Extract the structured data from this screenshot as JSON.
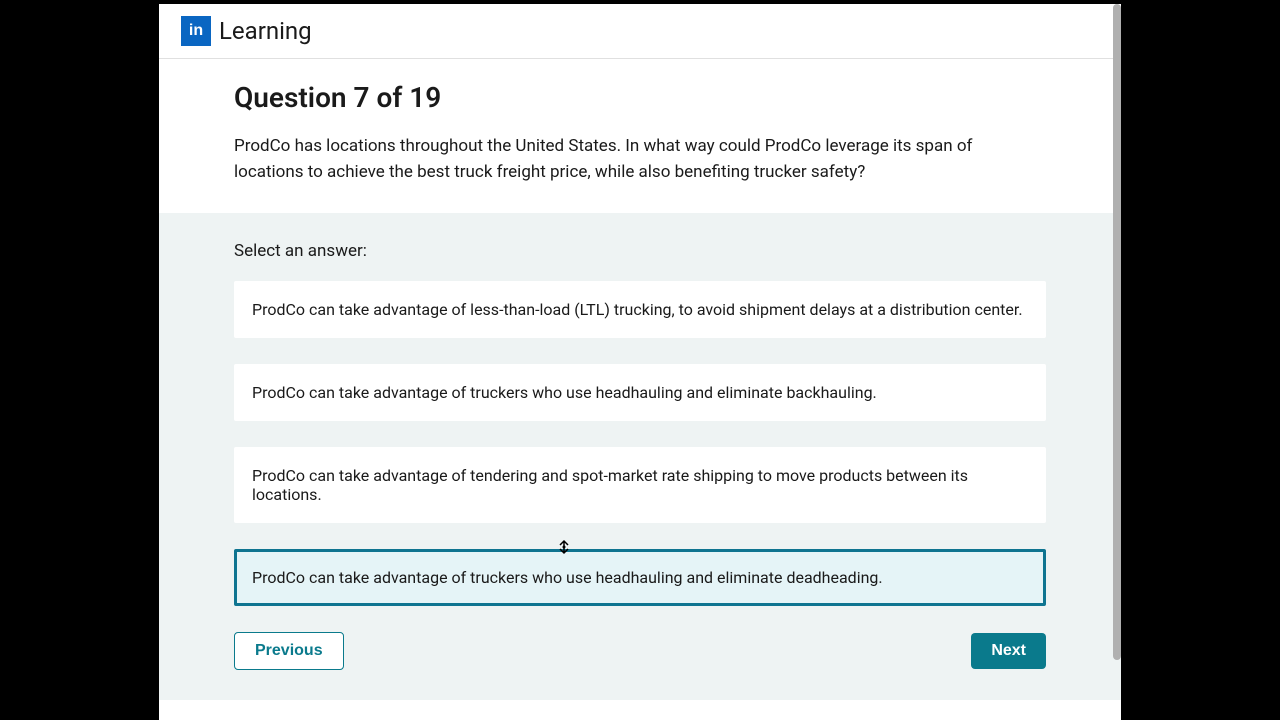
{
  "header": {
    "logo_text": "in",
    "brand": "Learning"
  },
  "quiz": {
    "title": "Question 7 of 19",
    "prompt": "ProdCo has locations throughout the United States. In what way could ProdCo leverage its span of locations to achieve the best truck freight price, while also benefiting trucker safety?",
    "select_label": "Select an answer:",
    "options": [
      "ProdCo can take advantage of less-than-load (LTL) trucking, to avoid shipment delays at a distribution center.",
      "ProdCo can take advantage of truckers who use headhauling and eliminate backhauling.",
      "ProdCo can take advantage of tendering and spot-market rate shipping to move products between its locations.",
      "ProdCo can take advantage of truckers who use headhauling and eliminate deadheading."
    ],
    "selected_index": 3
  },
  "nav": {
    "previous": "Previous",
    "next": "Next"
  }
}
